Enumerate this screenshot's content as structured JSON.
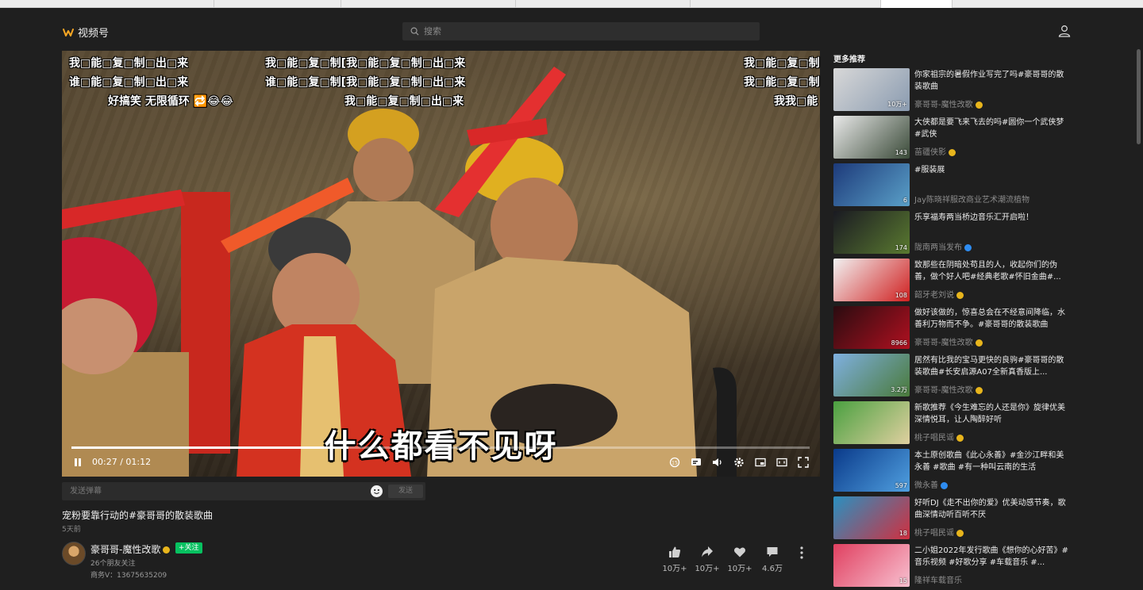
{
  "header": {
    "app_name": "视频号",
    "search_placeholder": "搜索"
  },
  "video": {
    "overlay_text_left": [
      "我□能□复□制□出□来",
      "谁□能□复□制□出□来",
      "好搞笑  无限循环 🔁😂😂"
    ],
    "overlay_text_center": [
      "我□能□复□制[我□能□复□制□出□来",
      "谁□能□复□制[我□能□复□制□出□来",
      "我□能□复□制□出□来"
    ],
    "overlay_text_right": [
      "我□能□复□制□出",
      "我□能□复□制□出",
      "我我□能"
    ],
    "subtitle": "什么都看不见呀",
    "current_time": "00:27",
    "duration": "01:12",
    "time_display": "00:27 / 01:12",
    "progress_fraction": 0.375
  },
  "danmu": {
    "placeholder": "发送弹幕",
    "send_label": "发送"
  },
  "post": {
    "title": "宠粉要靠行动的#豪哥哥的散装歌曲",
    "time": "5天前",
    "author": "豪哥哥-魔性改歌",
    "follow_label": "+关注",
    "friends_followed": "26个朋友关注",
    "business": "商务V：13675635209"
  },
  "actions": {
    "like": "10万+",
    "share": "10万+",
    "favorite": "10万+",
    "comment": "4.6万"
  },
  "sidebar": {
    "title": "更多推荐",
    "items": [
      {
        "title": "你家祖宗的暑假作业写完了吗#豪哥哥的散装歌曲",
        "author": "豪哥哥-魔性改歌",
        "likes": "10万+",
        "badge": "gold",
        "thumb": [
          "#d8d8d8",
          "#8a9bb0"
        ]
      },
      {
        "title": "大侠都是要飞来飞去的吗#圆你一个武侠梦#武侠",
        "author": "苗疆侠影",
        "likes": "143",
        "badge": "gold",
        "thumb": [
          "#e9e9e9",
          "#3a4a38"
        ]
      },
      {
        "title": "#服装展",
        "author": "Jay陈晓祥服改商业艺术潮流植物",
        "likes": "6",
        "badge": "",
        "thumb": [
          "#1d3a7a",
          "#5aa0c8"
        ]
      },
      {
        "title": "乐享福寿两当桥边音乐汇开启啦！",
        "author": "陇南两当发布",
        "likes": "174",
        "badge": "blue",
        "thumb": [
          "#1a1a22",
          "#5a7a30"
        ]
      },
      {
        "title": "致那些在阴暗处苟且的人，收起你们的伪善，做个好人吧#经典老歌#怀旧金曲#...",
        "author": "韶牙老刘说",
        "likes": "108",
        "badge": "gold",
        "thumb": [
          "#f2f2f2",
          "#d02020"
        ]
      },
      {
        "title": "做好该做的，惊喜总会在不经意间降临，水善利万物而不争。#豪哥哥的散装歌曲",
        "author": "豪哥哥-魔性改歌",
        "likes": "8966",
        "badge": "gold",
        "thumb": [
          "#2a0c10",
          "#b01020"
        ]
      },
      {
        "title": "居然有比我的宝马更快的良驹#豪哥哥的散装歌曲#长安启源A07全新真香版上...",
        "author": "豪哥哥-魔性改歌",
        "likes": "3.2万",
        "badge": "gold",
        "thumb": [
          "#7fb0e0",
          "#4a7a3a"
        ]
      },
      {
        "title": "新歌推荐《今生难忘的人还是你》旋律优美深情悦耳，让人陶醉好听",
        "author": "桃子唱民谣",
        "likes": "",
        "badge": "gold",
        "thumb": [
          "#4aa040",
          "#e0d0a0"
        ]
      },
      {
        "title": "本土原创歌曲《此心永善》#金沙江畔和美永善 #歌曲 #有一种叫云南的生活",
        "author": "微永善",
        "likes": "597",
        "badge": "blue",
        "thumb": [
          "#0a3a8a",
          "#50a0e0"
        ]
      },
      {
        "title": "好听DJ《走不出你的爱》优美动感节奏，歌曲深情动听百听不厌",
        "author": "桃子唱民谣",
        "likes": "18",
        "badge": "gold",
        "thumb": [
          "#2a90c0",
          "#d03040"
        ]
      },
      {
        "title": "二小姐2022年发行歌曲《想你的心好苦》#音乐视频 #好歌分享 #车载音乐 #...",
        "author": "隆祥车载音乐",
        "likes": "15",
        "badge": "",
        "thumb": [
          "#e04060",
          "#f8c0d0"
        ]
      }
    ]
  }
}
